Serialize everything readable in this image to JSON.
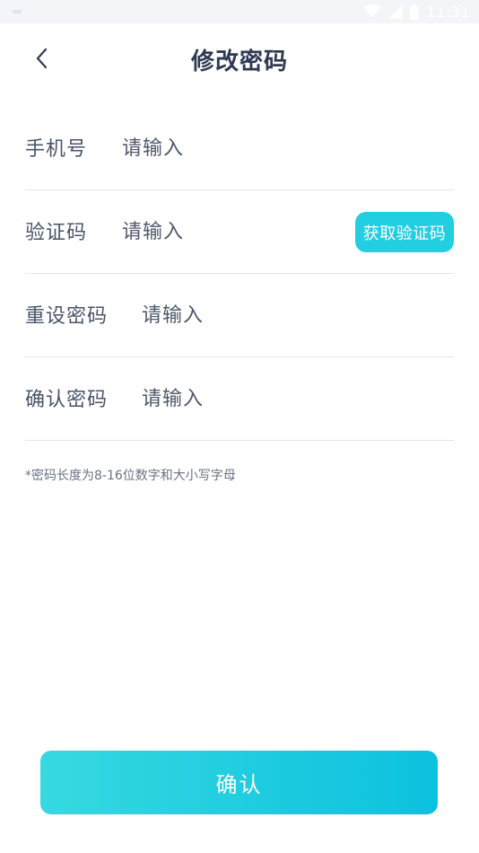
{
  "status_bar": {
    "time": "11:31"
  },
  "header": {
    "title": "修改密码",
    "back_icon": "chevron-left-icon"
  },
  "form": {
    "phone": {
      "label": "手机号",
      "placeholder": "请输入"
    },
    "code": {
      "label": "验证码",
      "placeholder": "请输入",
      "button_label": "获取验证码"
    },
    "new_password": {
      "label": "重设密码",
      "placeholder": "请输入"
    },
    "confirm_password": {
      "label": "确认密码",
      "placeholder": "请输入"
    }
  },
  "hint": "*密码长度为8-16位数字和大小写字母",
  "confirm_button": {
    "label": "确认"
  },
  "colors": {
    "accent": "#22cfe0",
    "gradient_start": "#36d9e0",
    "gradient_end": "#0cc1df",
    "divider": "#e4e7ee"
  }
}
